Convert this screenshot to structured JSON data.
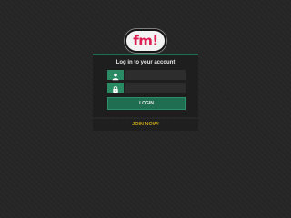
{
  "logo": {
    "text": "fm!"
  },
  "login_panel": {
    "title": "Log in to your account",
    "username_icon": "user-icon",
    "password_icon": "lock-icon",
    "username_value": "",
    "password_value": "",
    "login_label": "LOGIN"
  },
  "join": {
    "label": "JOIN NOW!"
  },
  "colors": {
    "background": "#262626",
    "panel": "#1e1e1e",
    "accent_green": "#1f6e52",
    "icon_green": "#2a8a63",
    "brand_pink": "#de1c52",
    "join_gold": "#c9a218"
  }
}
